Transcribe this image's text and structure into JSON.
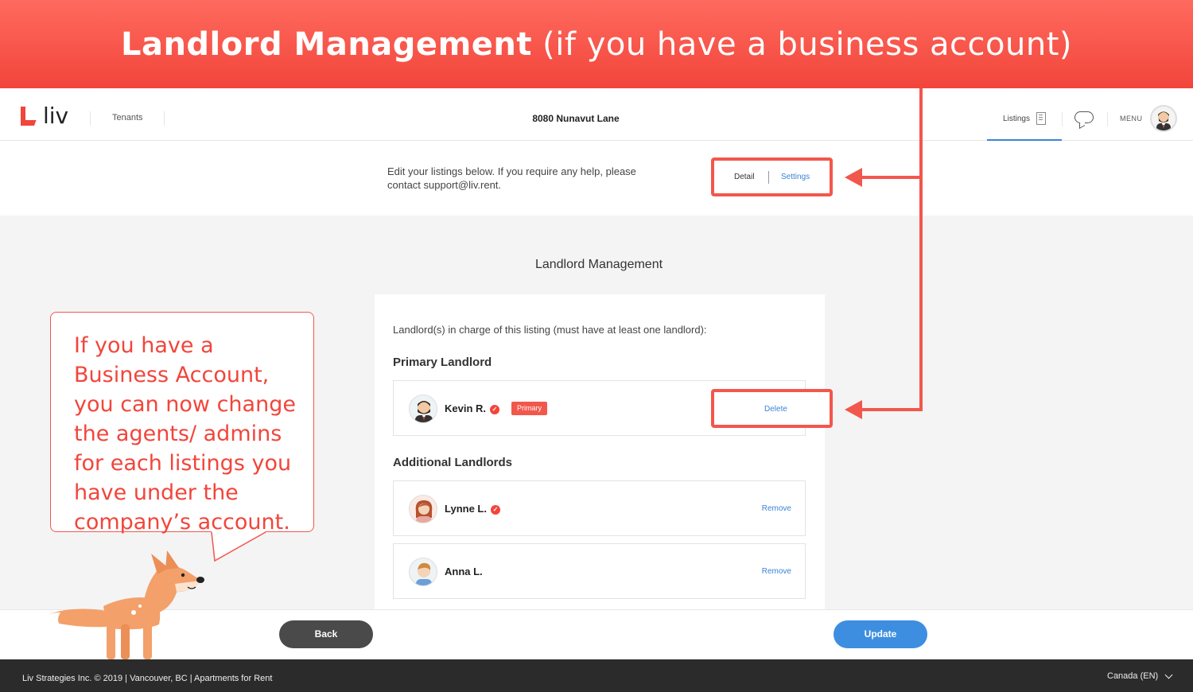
{
  "banner": {
    "title_bold": "Landlord Management",
    "title_rest": " (if you have a business account)"
  },
  "nav": {
    "logo_text": "liv",
    "tenants": "Tenants",
    "address": "8080 Nunavut Lane",
    "listings": "Listings",
    "menu": "MENU"
  },
  "edit": {
    "help_text": "Edit your listings below. If you require any help, please contact support@liv.rent.",
    "tab_detail": "Detail",
    "tab_settings": "Settings"
  },
  "main": {
    "section_title": "Landlord Management",
    "intro": "Landlord(s) in charge of this listing (must have at least one landlord):",
    "primary_heading": "Primary Landlord",
    "additional_heading": "Additional Landlords",
    "primary": {
      "name": "Kevin R.",
      "badge": "Primary",
      "action": "Delete"
    },
    "additional": [
      {
        "name": "Lynne L.",
        "verified": true,
        "action": "Remove"
      },
      {
        "name": "Anna L.",
        "verified": false,
        "action": "Remove"
      }
    ]
  },
  "bubble": {
    "text": "If you have a Business Account, you can now change the agents/ admins for each listings you have under the company’s account."
  },
  "actions": {
    "back": "Back",
    "update": "Update"
  },
  "footer": {
    "text": "Liv Strategies Inc. © 2019 | Vancouver, BC | Apartments for Rent",
    "region": "Canada (EN)"
  },
  "colors": {
    "accent": "#f2453b",
    "link": "#3a84d6",
    "update": "#3d8ee0",
    "back": "#4a4a4a"
  }
}
